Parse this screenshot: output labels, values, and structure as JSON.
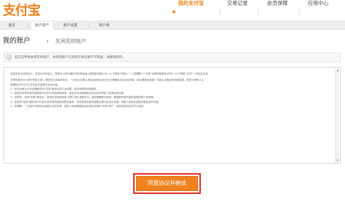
{
  "header": {
    "logo_text": "支付宝",
    "nav": [
      {
        "label": "我的支付宝",
        "active": true
      },
      {
        "label": "交易记录",
        "active": false
      },
      {
        "label": "会员保障",
        "active": false
      },
      {
        "label": "应用中心",
        "active": false
      }
    ]
  },
  "tabs": [
    {
      "label": "首页",
      "active": false
    },
    {
      "label": "账户资产",
      "active": true
    },
    {
      "label": "账户设置",
      "active": false
    },
    {
      "label": "账户通",
      "active": false
    }
  ],
  "title": {
    "main": "我的账户",
    "separator": "›",
    "crumb": "关闭花呗账户"
  },
  "notice": {
    "text": "您正在申请关闭花呗账户，关闭后账户信息和交易记录不可恢复，请谨慎操作。"
  },
  "agreement": {
    "lines": [
      "除您本协议另有定义，本协议中的定义、条款均以您与重庆市蚂蚁商诚小额贷款有限公司（以下简称“贷款人”）已签署的《“花呗”消费贷款服务合同》（以下简称“合同”）的约定为准。",
      "在您申请关闭“花呗”服务之前，请您充分阅读本协议，一旦您点击确认本协议即视为您已充分理解本协议内容条款（包括限制性条款）的含义及相应的法律后果，同意与贷款人以",
      "数据电文形式订立本协议并接受本协议约束。",
      "1、您在此确认已完全理解关闭“花呗”服务的含义及后果，您仍申请关闭该服务。",
      "2、您若在申请关闭花呗服务时仍存在未结清的款项，您应在关闭前按照合同约定向贷款人还清全部欠款。",
      "3、您同意，关闭“花呗”服务后，您将无法继续使用“花呗”进行消费支付；如您需要再次使用，需重新申请开通并接受贷款人的审核。",
      "4、若您在“花呗”服务项下仍存在未完成的退款或售后事项，您同意相关款项按照合同约定进行处理，贷款人有权在退款到账后进行冲抵。",
      "5、您理解，一旦您在本服务页面提交关闭申请，贷款人有权根据您的申请关闭您的“花呗”账户，相关信息将依法予以保存。"
    ]
  },
  "actions": {
    "agree_label": "同意协议并继续"
  }
}
